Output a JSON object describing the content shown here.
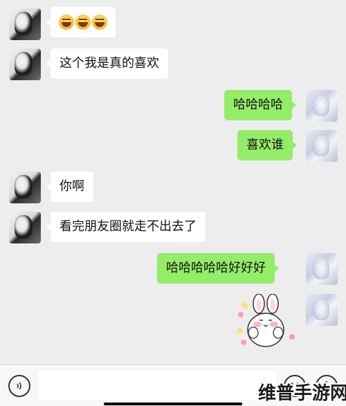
{
  "messages": [
    {
      "side": "left",
      "type": "emoji",
      "emoji_names": [
        "grinning-squint-face",
        "grinning-squint-face",
        "grinning-squint-face"
      ]
    },
    {
      "side": "left",
      "text": "这个我是真的喜欢"
    },
    {
      "side": "right",
      "text": "哈哈哈哈"
    },
    {
      "side": "right",
      "text": "喜欢谁"
    },
    {
      "side": "left",
      "text": "你啊"
    },
    {
      "side": "left",
      "text": "看完朋友圈就走不出去了"
    },
    {
      "side": "right",
      "text": "哈哈哈哈哈好好好"
    },
    {
      "side": "right",
      "type": "sticker",
      "sticker_name": "bunny-blushing-sticker"
    }
  ],
  "input_bar": {
    "placeholder": "",
    "voice_icon": "voice-icon",
    "emoji_icon": "smiley-icon",
    "plus_icon": "plus-icon"
  },
  "watermark": "维普手游网",
  "colors": {
    "background": "#ededed",
    "self_bubble": "#95ec69",
    "other_bubble": "#ffffff"
  }
}
